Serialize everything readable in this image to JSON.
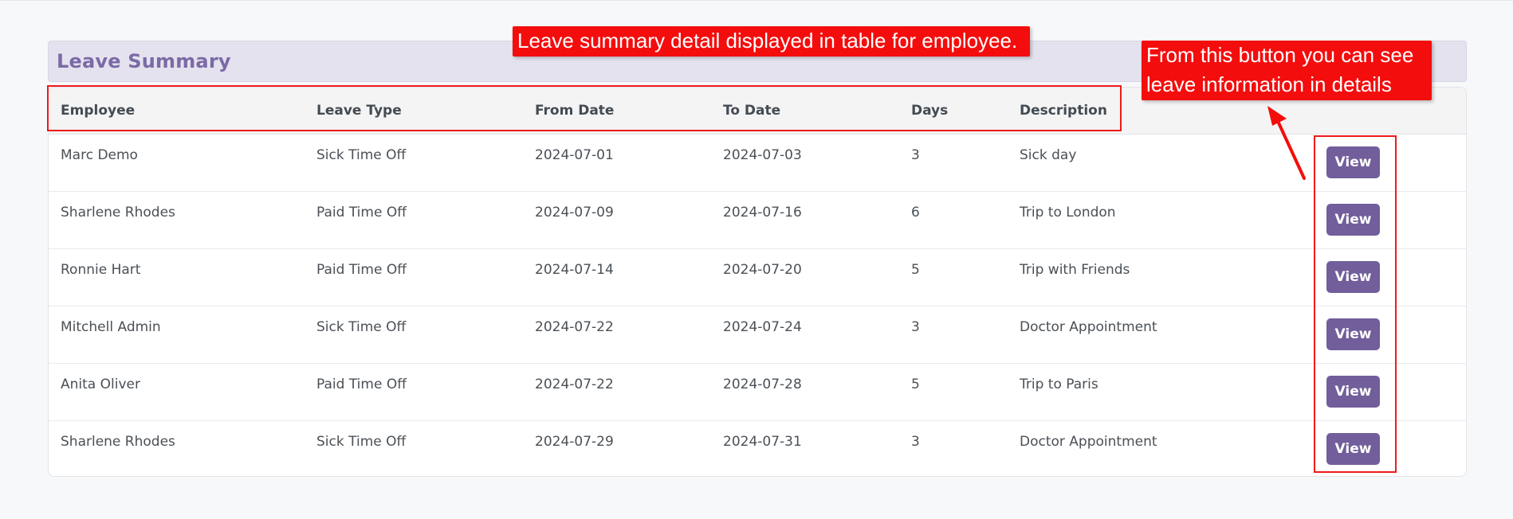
{
  "panel": {
    "title": "Leave Summary"
  },
  "table": {
    "columns": [
      "Employee",
      "Leave Type",
      "From Date",
      "To Date",
      "Days",
      "Description"
    ],
    "rows": [
      {
        "employee": "Marc Demo",
        "leave_type": "Sick Time Off",
        "from": "2024-07-01",
        "to": "2024-07-03",
        "days": "3",
        "description": "Sick day",
        "action": "View"
      },
      {
        "employee": "Sharlene Rhodes",
        "leave_type": "Paid Time Off",
        "from": "2024-07-09",
        "to": "2024-07-16",
        "days": "6",
        "description": "Trip to London",
        "action": "View"
      },
      {
        "employee": "Ronnie Hart",
        "leave_type": "Paid Time Off",
        "from": "2024-07-14",
        "to": "2024-07-20",
        "days": "5",
        "description": "Trip with Friends",
        "action": "View"
      },
      {
        "employee": "Mitchell Admin",
        "leave_type": "Sick Time Off",
        "from": "2024-07-22",
        "to": "2024-07-24",
        "days": "3",
        "description": "Doctor Appointment",
        "action": "View"
      },
      {
        "employee": "Anita Oliver",
        "leave_type": "Paid Time Off",
        "from": "2024-07-22",
        "to": "2024-07-28",
        "days": "5",
        "description": "Trip to Paris",
        "action": "View"
      },
      {
        "employee": "Sharlene Rhodes",
        "leave_type": "Sick Time Off",
        "from": "2024-07-29",
        "to": "2024-07-31",
        "days": "3",
        "description": "Doctor Appointment",
        "action": "View"
      }
    ]
  },
  "annotations": {
    "header_note": "Leave summary detail displayed in table for employee.",
    "button_note": "From this button you can see leave information in details"
  },
  "colors": {
    "accent": "#715e9b",
    "title": "#7b6aa6",
    "annotation": "#f40d0d"
  }
}
